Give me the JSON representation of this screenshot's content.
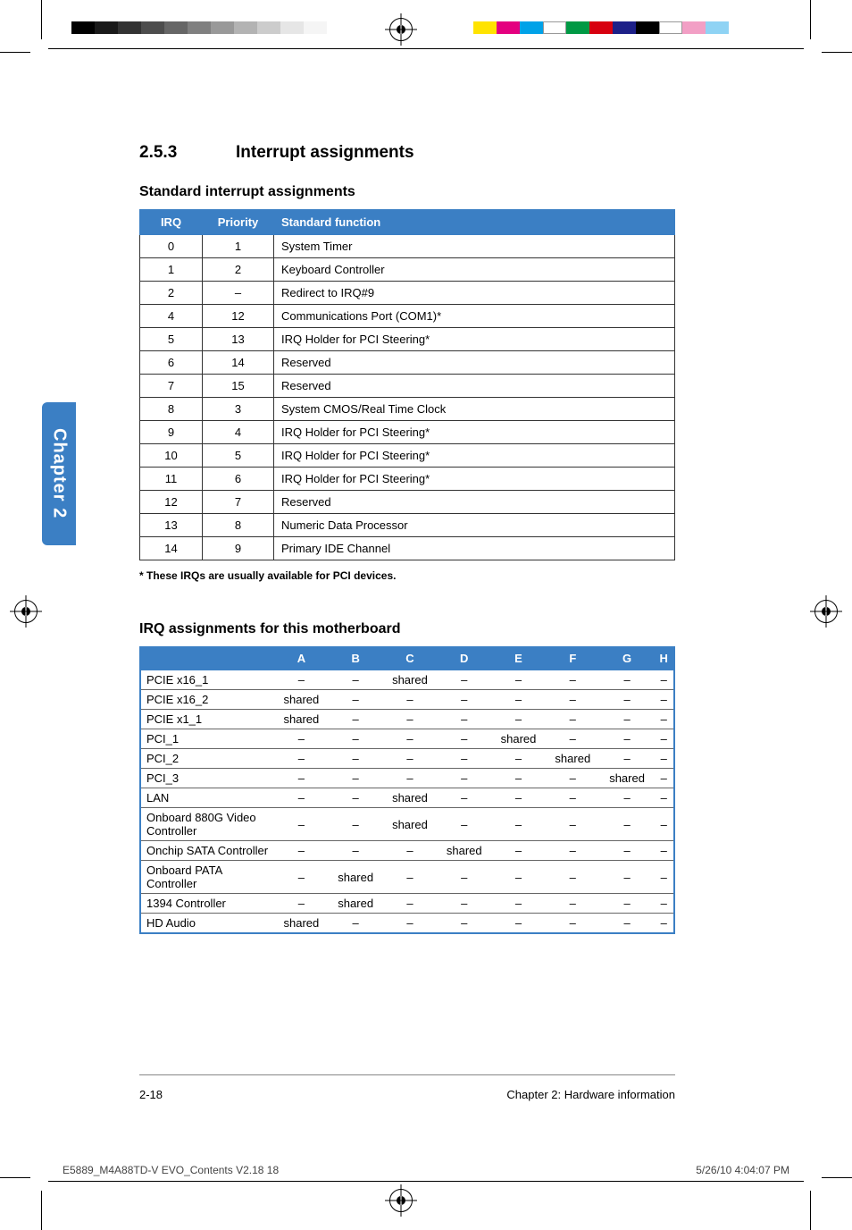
{
  "section": {
    "number": "2.5.3",
    "title": "Interrupt assignments"
  },
  "sub1": {
    "title": "Standard interrupt assignments"
  },
  "table1": {
    "headers": {
      "irq": "IRQ",
      "priority": "Priority",
      "func": "Standard function"
    },
    "rows": [
      {
        "irq": "0",
        "priority": "1",
        "func": "System Timer"
      },
      {
        "irq": "1",
        "priority": "2",
        "func": "Keyboard Controller"
      },
      {
        "irq": "2",
        "priority": "–",
        "func": "Redirect to IRQ#9"
      },
      {
        "irq": "4",
        "priority": "12",
        "func": "Communications Port (COM1)*"
      },
      {
        "irq": "5",
        "priority": "13",
        "func": "IRQ Holder for PCI Steering*"
      },
      {
        "irq": "6",
        "priority": "14",
        "func": "Reserved"
      },
      {
        "irq": "7",
        "priority": "15",
        "func": "Reserved"
      },
      {
        "irq": "8",
        "priority": "3",
        "func": "System CMOS/Real Time Clock"
      },
      {
        "irq": "9",
        "priority": "4",
        "func": "IRQ Holder for PCI Steering*"
      },
      {
        "irq": "10",
        "priority": "5",
        "func": "IRQ Holder for PCI Steering*"
      },
      {
        "irq": "11",
        "priority": "6",
        "func": "IRQ Holder for PCI Steering*"
      },
      {
        "irq": "12",
        "priority": "7",
        "func": "Reserved"
      },
      {
        "irq": "13",
        "priority": "8",
        "func": "Numeric Data Processor"
      },
      {
        "irq": "14",
        "priority": "9",
        "func": "Primary IDE Channel"
      }
    ]
  },
  "footnote1": "* These IRQs are usually available for PCI devices.",
  "sub2": {
    "title": "IRQ assignments for this motherboard"
  },
  "table2": {
    "cols": [
      "A",
      "B",
      "C",
      "D",
      "E",
      "F",
      "G",
      "H"
    ],
    "rows": [
      {
        "label": "PCIE x16_1",
        "cells": [
          "–",
          "–",
          "shared",
          "–",
          "–",
          "–",
          "–",
          "–"
        ]
      },
      {
        "label": "PCIE x16_2",
        "cells": [
          "shared",
          "–",
          "–",
          "–",
          "–",
          "–",
          "–",
          "–"
        ]
      },
      {
        "label": "PCIE x1_1",
        "cells": [
          "shared",
          "–",
          "–",
          "–",
          "–",
          "–",
          "–",
          "–"
        ]
      },
      {
        "label": "PCI_1",
        "cells": [
          "–",
          "–",
          "–",
          "–",
          "shared",
          "–",
          "–",
          "–"
        ]
      },
      {
        "label": "PCI_2",
        "cells": [
          "–",
          "–",
          "–",
          "–",
          "–",
          "shared",
          "–",
          "–"
        ]
      },
      {
        "label": "PCI_3",
        "cells": [
          "–",
          "–",
          "–",
          "–",
          "–",
          "–",
          "shared",
          "–"
        ]
      },
      {
        "label": "LAN",
        "cells": [
          "–",
          "–",
          "shared",
          "–",
          "–",
          "–",
          "–",
          "–"
        ]
      },
      {
        "label": "Onboard 880G Video Controller",
        "cells": [
          "–",
          "–",
          "shared",
          "–",
          "–",
          "–",
          "–",
          "–"
        ]
      },
      {
        "label": "Onchip SATA Controller",
        "cells": [
          "–",
          "–",
          "–",
          "shared",
          "–",
          "–",
          "–",
          "–"
        ]
      },
      {
        "label": "Onboard PATA Controller",
        "cells": [
          "–",
          "shared",
          "–",
          "–",
          "–",
          "–",
          "–",
          "–"
        ]
      },
      {
        "label": "1394 Controller",
        "cells": [
          "–",
          "shared",
          "–",
          "–",
          "–",
          "–",
          "–",
          "–"
        ]
      },
      {
        "label": "HD Audio",
        "cells": [
          "shared",
          "–",
          "–",
          "–",
          "–",
          "–",
          "–",
          "–"
        ]
      }
    ]
  },
  "chapter_tab": "Chapter 2",
  "footer": {
    "page": "2-18",
    "chapter": "Chapter 2: Hardware information"
  },
  "slug": {
    "file": "E5889_M4A88TD-V EVO_Contents V2.18   18",
    "datetime": "5/26/10   4:04:07 PM"
  }
}
